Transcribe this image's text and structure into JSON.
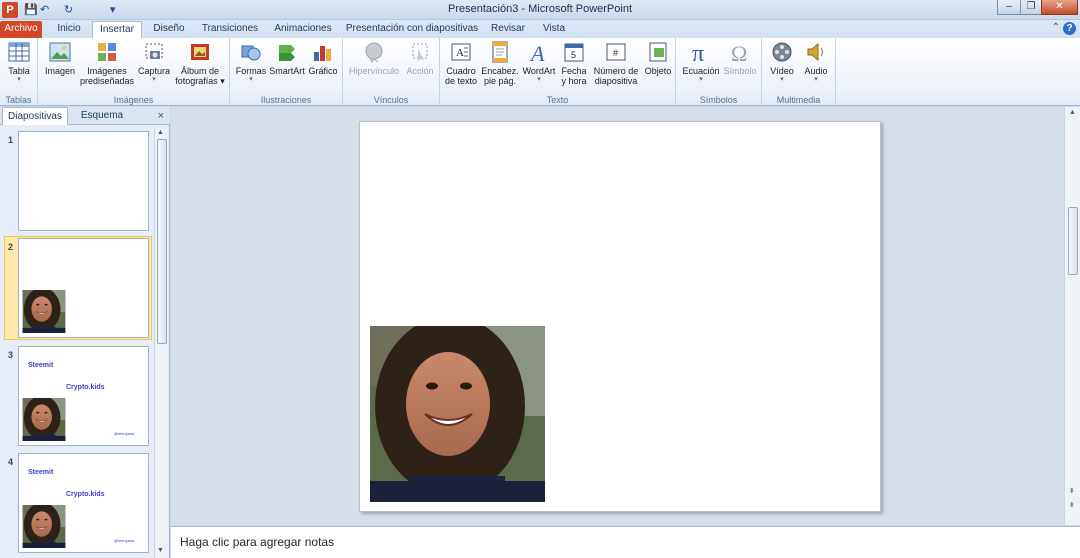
{
  "app": {
    "title": "Presentación3  -  Microsoft PowerPoint",
    "icon_letter": "P"
  },
  "quick_access": {
    "save": "💾",
    "undo": "↶",
    "redo": "↻",
    "customize": "▾"
  },
  "window_buttons": {
    "minimize": "–",
    "restore": "❐",
    "close": "✕"
  },
  "tabs": [
    {
      "label": "Archivo"
    },
    {
      "label": "Inicio"
    },
    {
      "label": "Insertar"
    },
    {
      "label": "Diseño"
    },
    {
      "label": "Transiciones"
    },
    {
      "label": "Animaciones"
    },
    {
      "label": "Presentación con diapositivas"
    },
    {
      "label": "Revisar"
    },
    {
      "label": "Vista"
    }
  ],
  "active_tab": "Insertar",
  "help": "?",
  "ribbon": {
    "tablas": {
      "label": "Tablas",
      "tabla": "Tabla"
    },
    "imagenes": {
      "label": "Imágenes",
      "imagen": "Imagen",
      "predis_1": "Imágenes",
      "predis_2": "prediseñadas",
      "captura": "Captura",
      "album_1": "Álbum de",
      "album_2": "fotografías"
    },
    "ilustraciones": {
      "label": "Ilustraciones",
      "formas": "Formas",
      "smartart": "SmartArt",
      "grafico": "Gráfico"
    },
    "vinculos": {
      "label": "Vínculos",
      "hipervinculo": "Hipervínculo",
      "accion": "Acción"
    },
    "texto": {
      "label": "Texto",
      "cuadro_1": "Cuadro",
      "cuadro_2": "de texto",
      "encab_1": "Encabez.",
      "encab_2": "pie pág.",
      "wordart": "WordArt",
      "fecha_1": "Fecha",
      "fecha_2": "y hora",
      "numero_1": "Número de",
      "numero_2": "diapositiva",
      "objeto": "Objeto"
    },
    "simbolos": {
      "label": "Símbolos",
      "ecuacion": "Ecuación",
      "simbolo": "Símbolo"
    },
    "multimedia": {
      "label": "Multimedia",
      "video": "Vídeo",
      "audio": "Audio"
    }
  },
  "pane": {
    "tab_slides": "Diapositivas",
    "tab_outline": "Esquema",
    "close": "×",
    "slides": [
      {
        "num": "1"
      },
      {
        "num": "2"
      },
      {
        "num": "3",
        "title": "Steemit",
        "subtitle": "Crypto.kids",
        "handle": "@lennyana"
      },
      {
        "num": "4",
        "title": "Steemit",
        "subtitle": "Crypto.kids",
        "handle": "@lennyana"
      }
    ],
    "selected_slide": 2
  },
  "notes": {
    "placeholder": "Haga clic para agregar notas"
  },
  "colors": {
    "file_tab": "#d24726",
    "thumb_text": "#3e3ecf",
    "selection": "#fde9a8"
  }
}
